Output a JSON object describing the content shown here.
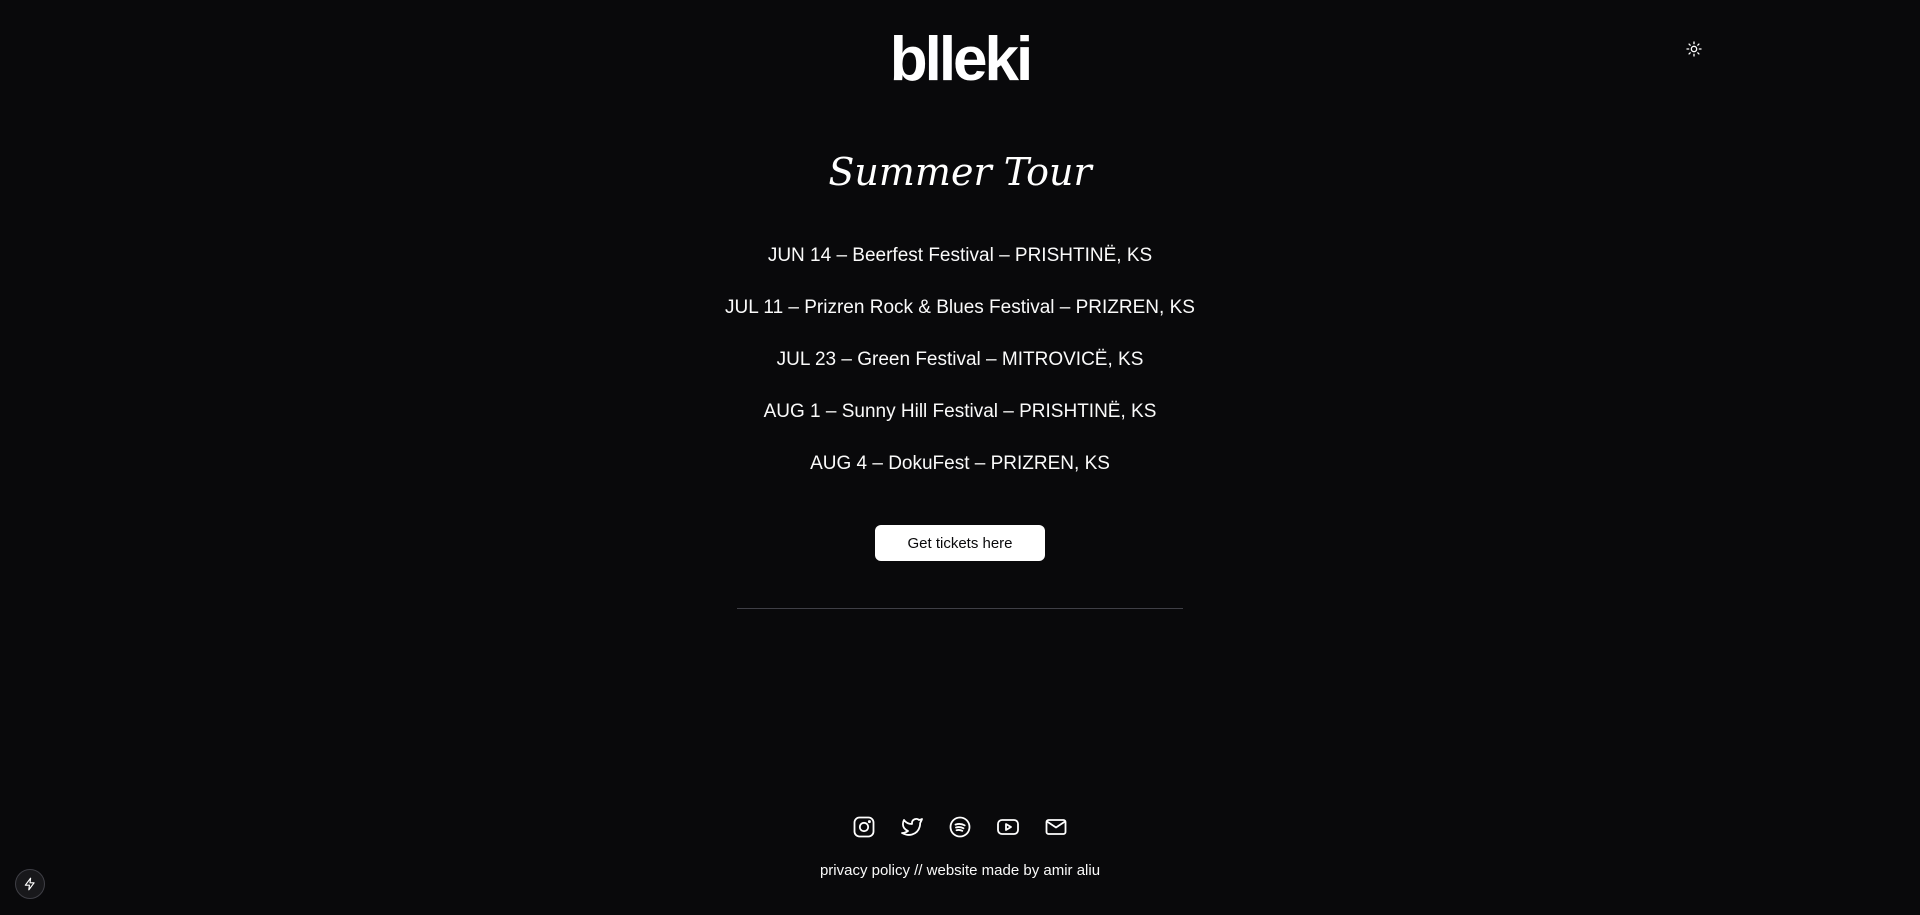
{
  "header": {
    "logo": "blleki",
    "theme_toggle_icon": "sun-icon"
  },
  "main": {
    "title": "Summer Tour",
    "dates": [
      "JUN 14 – Beerfest Festival – PRISHTINË, KS",
      "JUL 11 – Prizren Rock & Blues Festival – PRIZREN, KS",
      "JUL 23 – Green Festival – MITROVICË, KS",
      "AUG 1 – Sunny Hill Festival – PRISHTINË, KS",
      "AUG 4 – DokuFest – PRIZREN, KS"
    ],
    "tickets_label": "Get tickets here"
  },
  "footer": {
    "socials": [
      "instagram-icon",
      "twitter-icon",
      "spotify-icon",
      "youtube-icon",
      "mail-icon"
    ],
    "privacy_label": "privacy policy",
    "separator": " // ",
    "credit_label": "website made by amir aliu"
  },
  "colors": {
    "background": "#09090b",
    "foreground": "#fafafa",
    "button_bg": "#ffffff",
    "divider": "#3f3f46"
  }
}
